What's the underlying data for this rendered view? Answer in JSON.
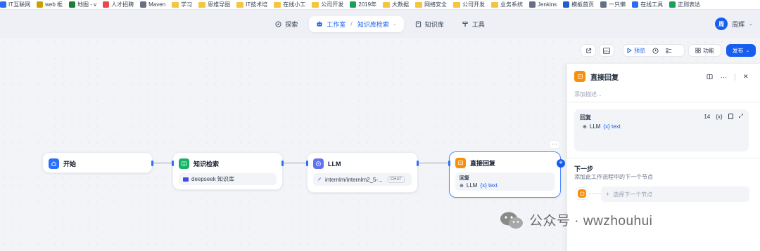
{
  "bookmarks": [
    {
      "label": "IT互联网",
      "kind": "fav",
      "color": "#2b6cf0"
    },
    {
      "label": "web 框",
      "kind": "fav",
      "color": "#c8a000"
    },
    {
      "label": "地图 - v",
      "kind": "fav",
      "color": "#1a7f37"
    },
    {
      "label": "人才招聘",
      "kind": "fav",
      "color": "#e5484d"
    },
    {
      "label": "Maven",
      "kind": "fav",
      "color": "#667085"
    },
    {
      "label": "学习",
      "kind": "folder"
    },
    {
      "label": "思维导图",
      "kind": "folder"
    },
    {
      "label": "IT技术培",
      "kind": "folder"
    },
    {
      "label": "在线小工",
      "kind": "folder"
    },
    {
      "label": "公司开发",
      "kind": "folder"
    },
    {
      "label": "2019年",
      "kind": "fav",
      "color": "#18a058"
    },
    {
      "label": "大数据",
      "kind": "folder"
    },
    {
      "label": "网络安全",
      "kind": "folder"
    },
    {
      "label": "公司开发",
      "kind": "folder"
    },
    {
      "label": "业务系统",
      "kind": "folder"
    },
    {
      "label": "Jenkins",
      "kind": "fav",
      "color": "#667085"
    },
    {
      "label": "模板首页",
      "kind": "fav",
      "color": "#1f5fcc"
    },
    {
      "label": "一只懒",
      "kind": "fav",
      "color": "#667085"
    },
    {
      "label": "在线工具",
      "kind": "fav",
      "color": "#2b6cf0"
    },
    {
      "label": "正则表达",
      "kind": "fav",
      "color": "#18a058"
    }
  ],
  "nav": {
    "explore": "探索",
    "studio": "工作室",
    "app_name": "知识库检索",
    "knowledge": "知识库",
    "tools": "工具"
  },
  "user": {
    "avatar": "周",
    "name": "周辉"
  },
  "toolbar": {
    "preview": "预览",
    "features": "功能",
    "publish": "发布"
  },
  "nodes": {
    "start": {
      "title": "开始"
    },
    "kb": {
      "title": "知识检索",
      "dataset": "deepseek 知识库"
    },
    "llm": {
      "title": "LLM",
      "model": "internlm/internlm2_5-...",
      "mode": "CHAT"
    },
    "reply": {
      "title": "直接回复",
      "label": "回复",
      "var_source": "LLM",
      "var_name": "{x} text"
    }
  },
  "panel": {
    "title": "直接回复",
    "desc_placeholder": "添加描述...",
    "reply_label": "回复",
    "char_count": "14",
    "var_source": "LLM",
    "var_name": "{x} text",
    "var_btn": "{x}",
    "next_title": "下一步",
    "next_desc": "添加此工作流程中的下一个节点",
    "select_next": "选择下一个节点"
  },
  "watermark": {
    "text": "公众号 · wwzhouhui"
  },
  "colors": {
    "accent": "#155eef",
    "start": "#2970ff",
    "kb": "#16b364",
    "llm": "#6172f3",
    "reply": "#f79009"
  }
}
